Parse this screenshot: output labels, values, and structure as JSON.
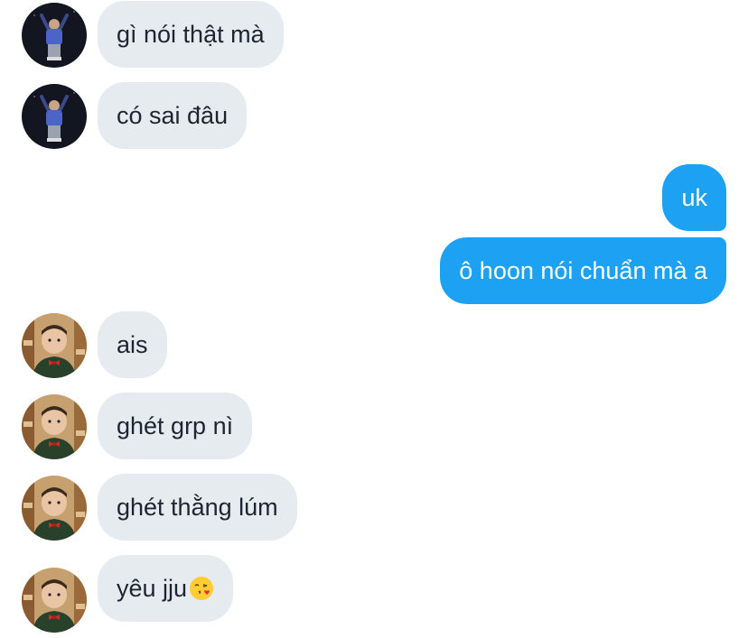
{
  "conversation": {
    "messages": [
      {
        "sender": "other",
        "avatar": "person-arms-raised-night-photo",
        "text": "gì nói thật mà"
      },
      {
        "sender": "other",
        "avatar": "person-arms-raised-night-photo",
        "text": "có sai đâu"
      },
      {
        "sender": "self",
        "text": "uk"
      },
      {
        "sender": "self",
        "text": "ô hoon nói chuẩn mà a"
      },
      {
        "sender": "other",
        "avatar": "boy-with-bowtie-photo",
        "text": "ais"
      },
      {
        "sender": "other",
        "avatar": "boy-with-bowtie-photo",
        "text": "ghét grp nì"
      },
      {
        "sender": "other",
        "avatar": "boy-with-bowtie-photo",
        "text": "ghét thằng lúm"
      },
      {
        "sender": "other",
        "avatar": "boy-with-bowtie-photo",
        "text": "yêu jju",
        "emoji": "face-blowing-a-kiss-emoji"
      }
    ]
  },
  "colors": {
    "incoming_bubble": "#e6ebf0",
    "incoming_text": "#1c2530",
    "outgoing_bubble": "#1da1f2",
    "outgoing_text": "#ffffff"
  }
}
